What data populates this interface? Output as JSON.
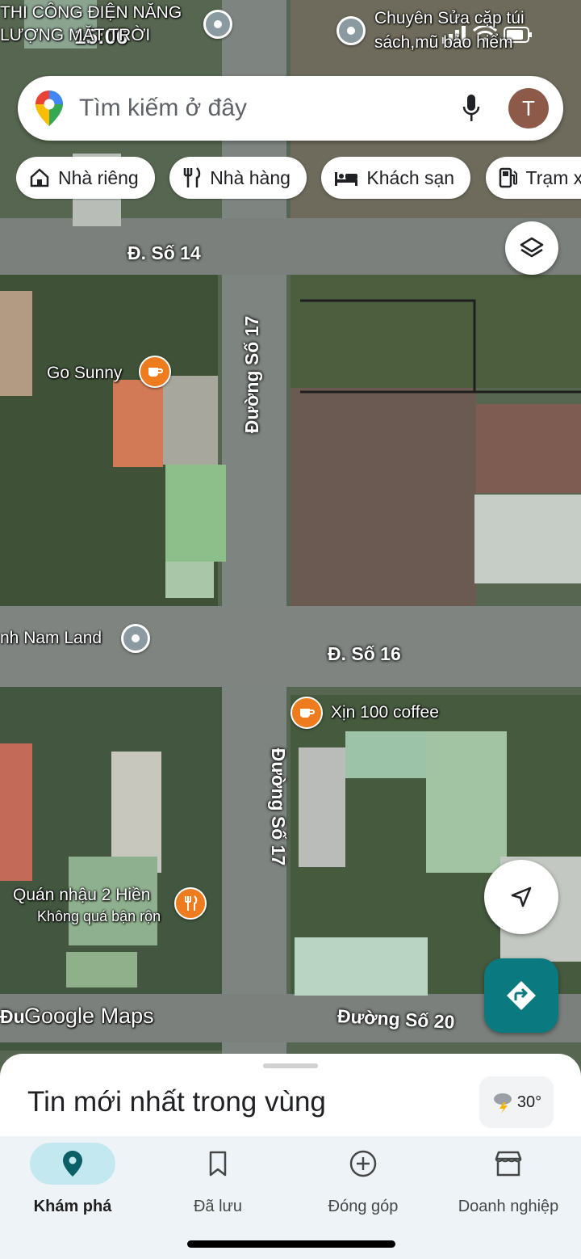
{
  "status_bar": {
    "time": "15:06"
  },
  "map": {
    "roads": {
      "so14": "Đ. Số 14",
      "so17_top": "Đường Số 17",
      "so16": "Đ. Số 16",
      "so17_bottom": "Đường Số 17",
      "so20": "Đường Số 20",
      "partial_left": "Đu"
    },
    "places": {
      "thi_cong": "THI CÔNG ĐIỆN NĂNG\nLƯỢNG MẶT TRỜI",
      "chuyen_sua": "Chuyên Sửa cặp túi\nsách,mũ bảo hiểm",
      "go_sunny": "Go Sunny",
      "nam_land": "nh Nam Land",
      "xin_coffee": "Xịn 100 coffee",
      "quan_nhau": "Quán nhậu 2 Hiền",
      "quan_nhau_sub": "Không quá bận rộn"
    },
    "watermark": "Google Maps"
  },
  "search": {
    "placeholder": "Tìm kiếm ở đây",
    "avatar_letter": "T"
  },
  "chips": [
    {
      "label": "Nhà riêng",
      "icon": "home-icon"
    },
    {
      "label": "Nhà hàng",
      "icon": "restaurant-icon"
    },
    {
      "label": "Khách sạn",
      "icon": "hotel-icon"
    },
    {
      "label": "Trạm xăng",
      "icon": "gas-station-icon"
    }
  ],
  "sheet": {
    "title": "Tin mới nhất trong vùng",
    "weather": "30°"
  },
  "nav": [
    {
      "label": "Khám phá",
      "icon": "explore-pin-icon",
      "active": true
    },
    {
      "label": "Đã lưu",
      "icon": "bookmark-icon",
      "active": false
    },
    {
      "label": "Đóng góp",
      "icon": "add-circle-icon",
      "active": false
    },
    {
      "label": "Doanh nghiệp",
      "icon": "storefront-icon",
      "active": false
    }
  ],
  "colors": {
    "accent": "#0b7a80",
    "poi_orange": "#ef7b1f",
    "nav_active": "#c4e8ef"
  }
}
